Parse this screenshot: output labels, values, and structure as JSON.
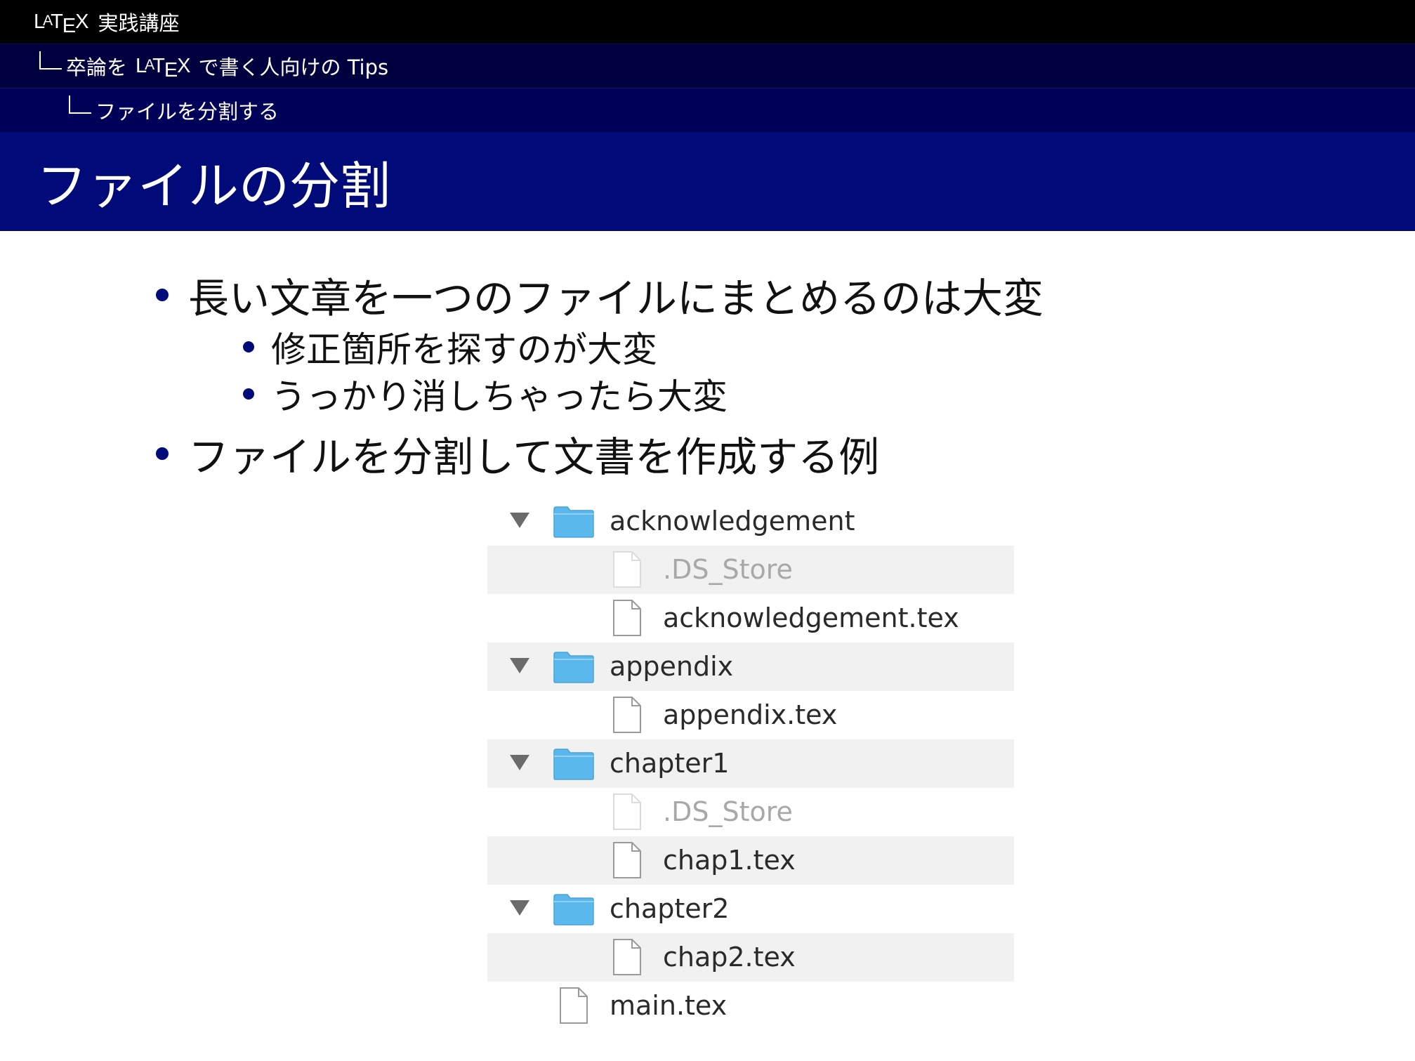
{
  "header": {
    "course_latex": {
      "l": "L",
      "a": "A",
      "t": "T",
      "e": "E",
      "x": "X"
    },
    "course_title": "実践講座",
    "section_prefix": "卒論を",
    "section_suffix": "で書く人向けの Tips",
    "subsection": "ファイルを分割する",
    "slide_title": "ファイルの分割"
  },
  "bullets": [
    {
      "level": 1,
      "text": "長い文章を一つのファイルにまとめるのは大変"
    },
    {
      "level": 2,
      "text": "修正箇所を探すのが大変"
    },
    {
      "level": 2,
      "text": "うっかり消しちゃったら大変"
    },
    {
      "level": 1,
      "text": "ファイルを分割して文書を作成する例"
    }
  ],
  "file_tree": [
    {
      "type": "folder",
      "name": "acknowledgement",
      "icon": "folder-icon",
      "expanded": true
    },
    {
      "type": "file",
      "name": ".DS_Store",
      "icon": "document-icon",
      "hidden": true
    },
    {
      "type": "file",
      "name": "acknowledgement.tex",
      "icon": "document-icon"
    },
    {
      "type": "folder",
      "name": "appendix",
      "icon": "folder-icon",
      "expanded": true
    },
    {
      "type": "file",
      "name": "appendix.tex",
      "icon": "document-icon"
    },
    {
      "type": "folder",
      "name": "chapter1",
      "icon": "folder-icon",
      "expanded": true
    },
    {
      "type": "file",
      "name": ".DS_Store",
      "icon": "document-icon",
      "hidden": true
    },
    {
      "type": "file",
      "name": "chap1.tex",
      "icon": "document-icon"
    },
    {
      "type": "folder",
      "name": "chapter2",
      "icon": "folder-icon",
      "expanded": true
    },
    {
      "type": "file",
      "name": "chap2.tex",
      "icon": "document-icon"
    },
    {
      "type": "file",
      "name": "main.tex",
      "icon": "document-icon"
    }
  ],
  "colors": {
    "header_black": "#000000",
    "header_navy_1": "#00003f",
    "header_navy_2": "#000058",
    "title_band": "#000a78",
    "bullet": "#000a78",
    "folder": "#5bb8ec",
    "row_stripe": "#f1f1f1"
  }
}
